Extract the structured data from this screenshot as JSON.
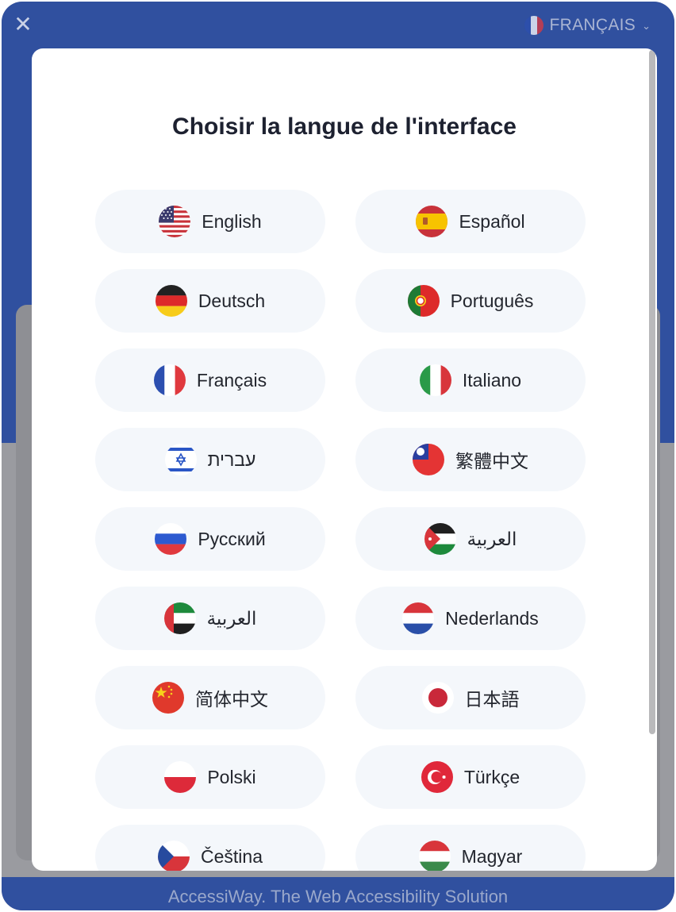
{
  "header": {
    "close_glyph": "✕",
    "current_language": "FRANÇAIS",
    "chevron": "⌄"
  },
  "modal": {
    "title": "Choisir la langue de l'interface"
  },
  "languages": [
    {
      "label": "English",
      "flag": "us-flag-icon"
    },
    {
      "label": "Español",
      "flag": "spain-flag-icon"
    },
    {
      "label": "Deutsch",
      "flag": "germany-flag-icon"
    },
    {
      "label": "Português",
      "flag": "portugal-flag-icon"
    },
    {
      "label": "Français",
      "flag": "france-flag-icon"
    },
    {
      "label": "Italiano",
      "flag": "italy-flag-icon"
    },
    {
      "label": "עברית",
      "flag": "israel-flag-icon"
    },
    {
      "label": "繁體中文",
      "flag": "taiwan-flag-icon"
    },
    {
      "label": "Русский",
      "flag": "russia-flag-icon"
    },
    {
      "label": "العربية",
      "flag": "jordan-flag-icon"
    },
    {
      "label": "العربية",
      "flag": "uae-flag-icon"
    },
    {
      "label": "Nederlands",
      "flag": "netherlands-flag-icon"
    },
    {
      "label": "简体中文",
      "flag": "china-flag-icon"
    },
    {
      "label": "日本語",
      "flag": "japan-flag-icon"
    },
    {
      "label": "Polski",
      "flag": "poland-flag-icon"
    },
    {
      "label": "Türkçe",
      "flag": "turkey-flag-icon"
    },
    {
      "label": "Čeština",
      "flag": "czech-flag-icon"
    },
    {
      "label": "Magyar",
      "flag": "hungary-flag-icon"
    }
  ],
  "footer": {
    "text": "AccessiWay. The Web Accessibility Solution"
  },
  "colors": {
    "brand_blue": "#30509f",
    "button_bg": "#f4f7fb",
    "title_text": "#1d2130"
  }
}
